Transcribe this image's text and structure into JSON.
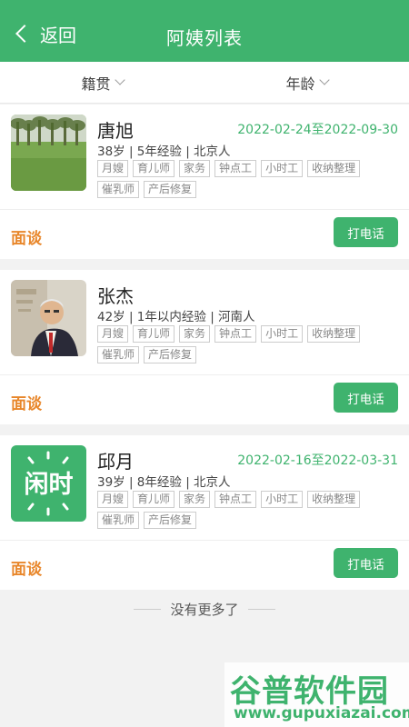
{
  "header": {
    "back_label": "返回",
    "title": "阿姨列表",
    "color": "#3fb36e"
  },
  "filters": [
    {
      "label": "籍贯"
    },
    {
      "label": "年龄"
    }
  ],
  "cards": [
    {
      "name": "唐旭",
      "date_range": "2022-02-24至2022-09-30",
      "meta": "38岁 | 5年经验 | 北京人",
      "tags": [
        "月嫂",
        "育儿师",
        "家务",
        "钟点工",
        "小时工",
        "收纳整理",
        "催乳师",
        "产后修复"
      ],
      "interview_label": "面谈",
      "call_label": "打电话"
    },
    {
      "name": "张杰",
      "date_range": "",
      "meta": "42岁 | 1年以内经验 | 河南人",
      "tags": [
        "月嫂",
        "育儿师",
        "家务",
        "钟点工",
        "小时工",
        "收纳整理",
        "催乳师",
        "产后修复"
      ],
      "interview_label": "面谈",
      "call_label": "打电话"
    },
    {
      "name": "邱月",
      "date_range": "2022-02-16至2022-03-31",
      "meta": "39岁 | 8年经验 | 北京人",
      "tags": [
        "月嫂",
        "育儿师",
        "家务",
        "钟点工",
        "小时工",
        "收纳整理",
        "催乳师",
        "产后修复"
      ],
      "interview_label": "面谈",
      "call_label": "打电话",
      "logo_text": "闲时"
    }
  ],
  "footer": {
    "no_more": "没有更多了"
  },
  "watermark": {
    "cn": "谷普软件园",
    "en": "www.gupuxiazai.com"
  },
  "colors": {
    "accent": "#3fb36e",
    "interview": "#e8862a"
  }
}
